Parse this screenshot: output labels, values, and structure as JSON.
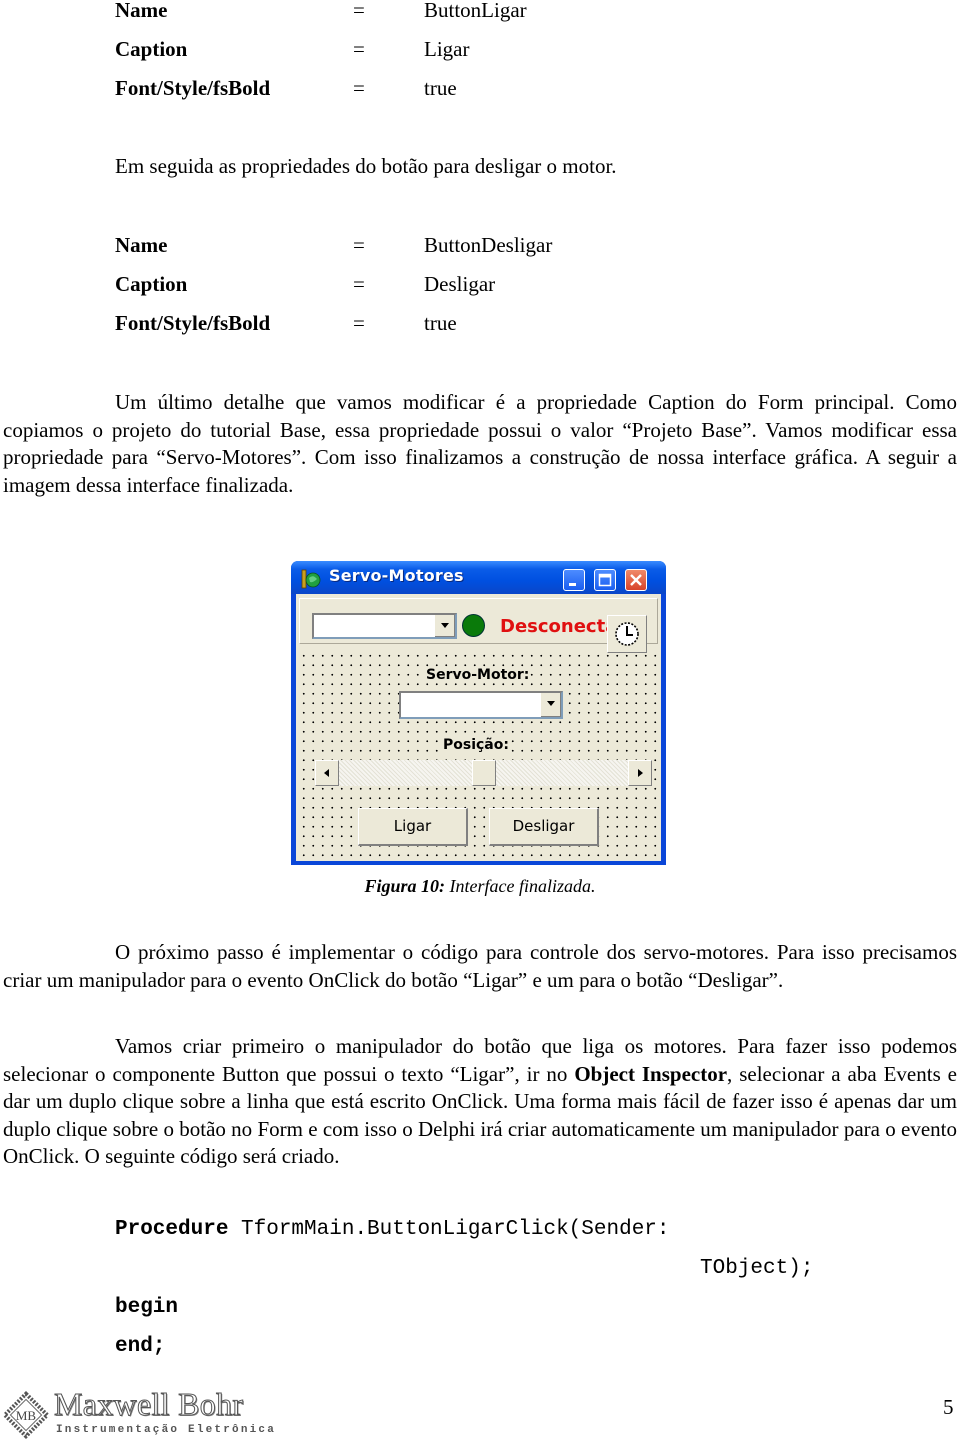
{
  "properties_ligar": [
    {
      "key": "Name",
      "eq": "=",
      "value": "ButtonLigar"
    },
    {
      "key": "Caption",
      "eq": "=",
      "value": "Ligar"
    },
    {
      "key": "Font/Style/fsBold",
      "eq": "=",
      "value": "true"
    }
  ],
  "intro_desligar": "Em seguida as propriedades do botão para desligar o motor.",
  "properties_desligar": [
    {
      "key": "Name",
      "eq": "=",
      "value": "ButtonDesligar"
    },
    {
      "key": "Caption",
      "eq": "=",
      "value": "Desligar"
    },
    {
      "key": "Font/Style/fsBold",
      "eq": "=",
      "value": "true"
    }
  ],
  "paragraph_caption": "Um último detalhe que vamos modificar é a propriedade Caption do Form principal. Como copiamos o projeto do tutorial Base, essa propriedade possui o valor “Projeto Base”. Vamos modificar essa propriedade para “Servo-Motores”. Com isso finalizamos a construção de nossa interface gráfica. A seguir a imagem dessa interface finalizada.",
  "figure": {
    "window": {
      "title": "Servo-Motores",
      "minimize_icon": "minimize-icon",
      "maximize_icon": "maximize-icon",
      "close_icon": "close-icon",
      "port_combo_value": "",
      "status_led_color": "#0a7a0a",
      "status_text": "Desconectado",
      "status_color": "#e01010",
      "timer_icon": "clock-icon",
      "servo_label": "Servo-Motor:",
      "servo_combo_value": "",
      "position_label": "Posição:",
      "position_value_fraction": 0.5,
      "button_ligar": "Ligar",
      "button_desligar": "Desligar"
    },
    "caption_bold": "Figura 10:",
    "caption_text": " Interface finalizada."
  },
  "paragraph_next": "O próximo passo é implementar o código para controle dos servo-motores. Para isso precisamos criar um manipulador para o evento OnClick do botão “Ligar” e um para o botão “Desligar”.",
  "paragraph_handler": {
    "part1": "Vamos criar primeiro o manipulador do botão que liga os motores. Para fazer isso podemos selecionar o componente Button que possui o texto “Ligar”, ir no ",
    "bold": "Object Inspector",
    "part2": ", selecionar a aba Events e dar um duplo clique sobre a linha que está escrito OnClick. Uma forma mais fácil de fazer isso é apenas dar um duplo clique sobre o botão no Form e com isso o Delphi irá criar automaticamente um manipulador para o evento OnClick. O seguinte código será criado."
  },
  "code": {
    "keyword_procedure": "Procedure",
    "signature": " TformMain.ButtonLigarClick(Sender:",
    "continuation": "TObject);",
    "begin": "begin",
    "end": "end;"
  },
  "footer": {
    "logo_text": "Maxwell Bohr",
    "logo_subtitle": "Instrumentação Eletrônica",
    "logo_badge": "MB",
    "page_number": "5"
  }
}
